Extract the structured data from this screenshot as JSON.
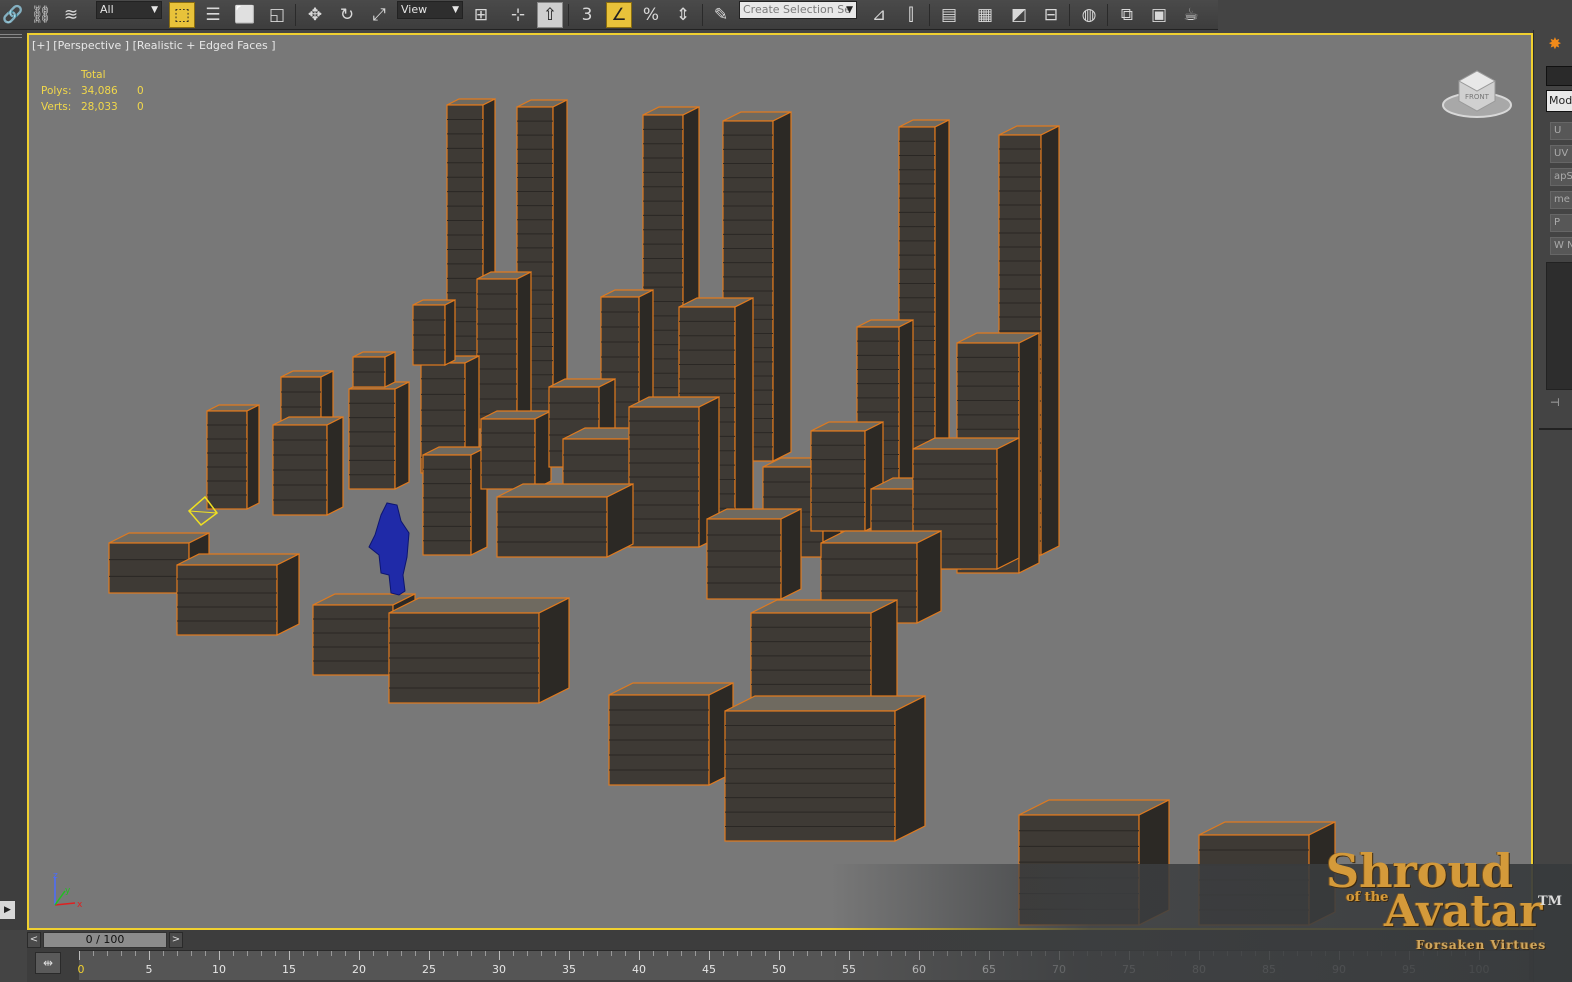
{
  "toolbar": {
    "selection_filter": "All",
    "reference_coord": "View",
    "snap_3d": "3",
    "percent_snap": "%",
    "selection_set_placeholder": "Create Selection Se"
  },
  "viewport": {
    "label": "[+] [Perspective ] [Realistic + Edged Faces ]",
    "stats": {
      "header": "Total",
      "polys_label": "Polys:",
      "polys_total": "34,086",
      "polys_selected": "0",
      "verts_label": "Verts:",
      "verts_total": "28,033",
      "verts_selected": "0"
    },
    "viewcube_face": "FRONT",
    "axis_labels": {
      "x": "x",
      "y": "y",
      "z": "z"
    }
  },
  "command_panel": {
    "modifier_list": "Mod",
    "tabs": [
      "U",
      "UV",
      "apS",
      "me",
      "P",
      "W N"
    ]
  },
  "timeline": {
    "frame_display": "0 / 100",
    "current_frame": "0",
    "ruler_labels": [
      "5",
      "10",
      "15",
      "20",
      "25",
      "30",
      "35",
      "40",
      "45",
      "50",
      "55",
      "60",
      "65",
      "70",
      "75",
      "80",
      "85",
      "90",
      "95",
      "100"
    ]
  },
  "logo": {
    "line1": "Shroud",
    "line2": "of the",
    "line3": "Avatar",
    "trademark": "TM",
    "subtitle": "Forsaken Virtues"
  },
  "colors": {
    "viewport_bg": "#787878",
    "active_border": "#f0d030",
    "selection_wire": "#e07a1e",
    "stats_text": "#f2d84a",
    "character": "#1f2aa8"
  },
  "icons": [
    "link-icon",
    "unlink-icon",
    "bind-spacewarp-icon",
    "select-object-icon",
    "select-by-name-icon",
    "rect-region-icon",
    "window-crossing-icon",
    "move-icon",
    "rotate-icon",
    "scale-icon",
    "pivot-icon",
    "manipulate-icon",
    "keyboard-shortcut-icon",
    "snap-3d-icon",
    "angle-snap-icon",
    "percent-snap-icon",
    "spinner-snap-icon",
    "edit-named-sets-icon",
    "mirror-icon",
    "align-icon",
    "layer-manager-icon",
    "scene-explorer-icon",
    "curve-editor-icon",
    "schematic-view-icon",
    "material-editor-icon",
    "render-setup-icon",
    "rendered-frame-icon",
    "render-teapot-icon",
    "create-panel-icon"
  ]
}
